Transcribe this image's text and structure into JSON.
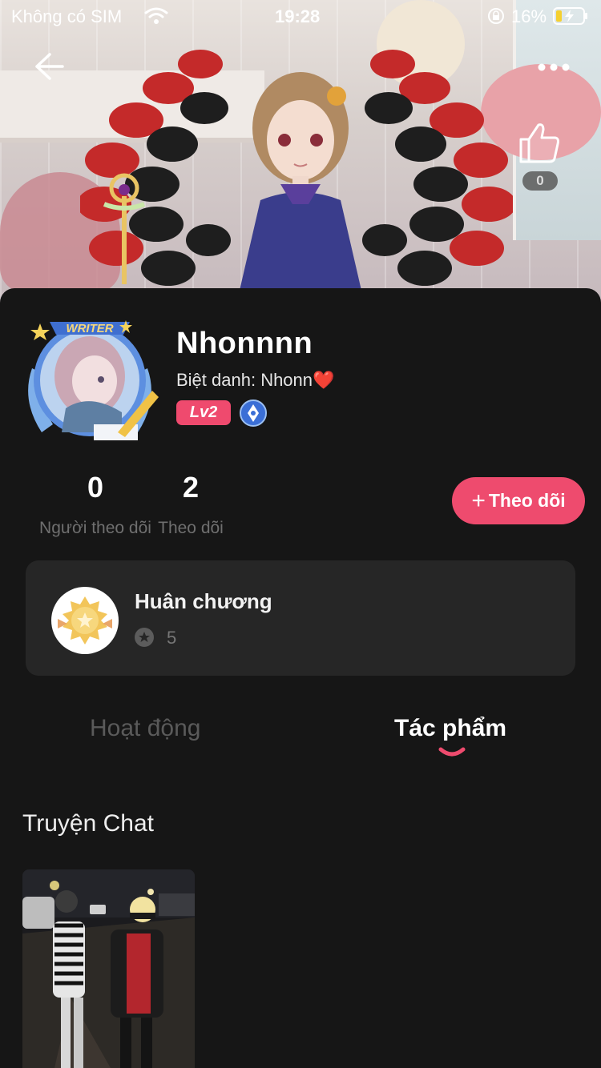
{
  "status_bar": {
    "carrier": "Không có SIM",
    "time": "19:28",
    "battery": "16%"
  },
  "header": {
    "like_count": "0",
    "icons": [
      "back-arrow-icon",
      "more-dots-icon",
      "thumbs-up-icon"
    ]
  },
  "profile": {
    "avatar_frame_label": "WRITER",
    "name": "Nhonnnn",
    "nickname": "Biệt danh: Nhonn",
    "nickname_emoji": "❤️",
    "level": "Lv2",
    "followers_count": "0",
    "followers_label": "Người theo dõi",
    "following_count": "2",
    "following_label": "Theo dõi",
    "follow_button": "Theo dõi"
  },
  "medals": {
    "title": "Huân chương",
    "count": "5"
  },
  "tabs": [
    {
      "label": "Hoạt động",
      "active": false
    },
    {
      "label": "Tác phẩm",
      "active": true
    }
  ],
  "section": {
    "title": "Truyện Chat"
  },
  "colors": {
    "accent": "#ee4b6e",
    "background": "#161616",
    "card": "#262626",
    "muted_text": "#6f6f6f"
  }
}
